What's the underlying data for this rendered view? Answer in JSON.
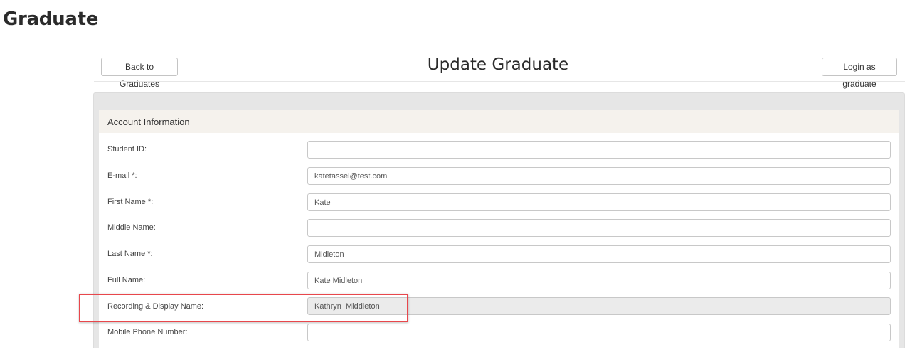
{
  "page": {
    "heading": "Graduate"
  },
  "toolbar": {
    "back_label": "Back to Graduates",
    "title": "Update Graduate",
    "login_label": "Login as graduate"
  },
  "account_section": {
    "title": "Account Information",
    "fields": [
      {
        "label": "Student ID:",
        "value": "",
        "disabled": false
      },
      {
        "label": "E-mail *:",
        "value": "katetassel@test.com",
        "disabled": false
      },
      {
        "label": "First Name *:",
        "value": "Kate",
        "disabled": false
      },
      {
        "label": "Middle Name:",
        "value": "",
        "disabled": false
      },
      {
        "label": "Last Name *:",
        "value": "Midleton",
        "disabled": false
      },
      {
        "label": "Full Name:",
        "value": "Kate Midleton",
        "disabled": false
      },
      {
        "label": "Recording & Display Name:",
        "value": "Kathryn  Middleton",
        "disabled": true
      },
      {
        "label": "Mobile Phone Number:",
        "value": "",
        "disabled": false
      }
    ]
  },
  "colors": {
    "highlight_border": "#e8474c",
    "section_header_bg": "#f5f2ed",
    "panel_bg": "#e6e6e6",
    "disabled_input_bg": "#ebebeb"
  }
}
